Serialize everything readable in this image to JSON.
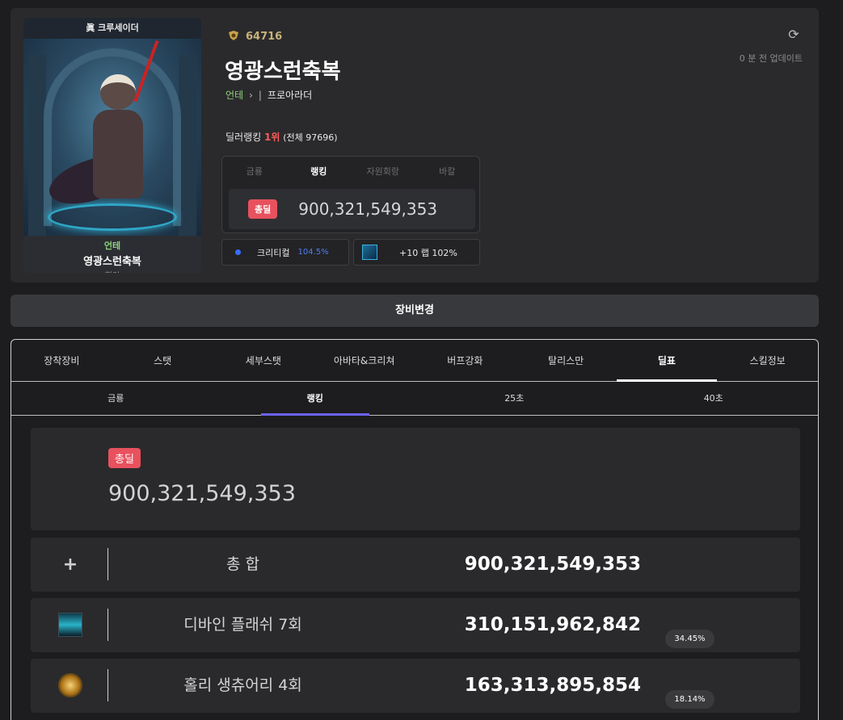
{
  "profile": {
    "server_label": "眞 크루세이더",
    "card_world": "언테",
    "card_name": "영광스런축복",
    "card_guild": "힐더",
    "trophy_value": "64716",
    "name": "영광스런축복",
    "world": "언테",
    "world_chevron": "›",
    "separator": "|",
    "job": "프로아라더",
    "updated_num": "0",
    "updated_text": "분 전 업데이트",
    "rank_prefix": "딜러랭킹",
    "rank_value": "1위",
    "rank_total": "(전체 97696)"
  },
  "deal_box": {
    "tabs": [
      "금룡",
      "랭킹",
      "자원회랑",
      "바칼"
    ],
    "active_tab": "랭킹",
    "badge": "총딜",
    "value": "900,321,549,353"
  },
  "chips": {
    "crit_label": "크리티컬",
    "crit_pct": "104.5%",
    "gear_text": "+10 랩 102%"
  },
  "equip_button": "장비변경",
  "main_tabs": [
    "장착장비",
    "스탯",
    "세부스탯",
    "아바타&크리쳐",
    "버프강화",
    "탈리스만",
    "딜표",
    "스킬정보"
  ],
  "active_main_tab": "딜표",
  "sub_tabs": [
    "금룡",
    "랭킹",
    "25초",
    "40초"
  ],
  "active_sub_tab": "랭킹",
  "total_card": {
    "badge": "총딜",
    "value": "900,321,549,353"
  },
  "rows": [
    {
      "icon": "plus-icon",
      "name": "총 합",
      "value": "900,321,549,353",
      "pct": ""
    },
    {
      "icon": "divine-flash-skill-icon",
      "name": "디바인 플래쉬 7회",
      "value": "310,151,962,842",
      "pct": "34.45%"
    },
    {
      "icon": "holy-sanctuary-skill-icon",
      "name": "홀리 생츄어리 4회",
      "value": "163,313,895,854",
      "pct": "18.14%"
    }
  ],
  "colors": {
    "background": "#1d1d1f",
    "panel": "#2a2a2c",
    "deal_badge": "#e8515e",
    "world_green": "#8fd07c",
    "rank_red": "#ff5b5b",
    "crit_blue": "#4f7df3",
    "subtab_underline": "#6d63f5"
  }
}
